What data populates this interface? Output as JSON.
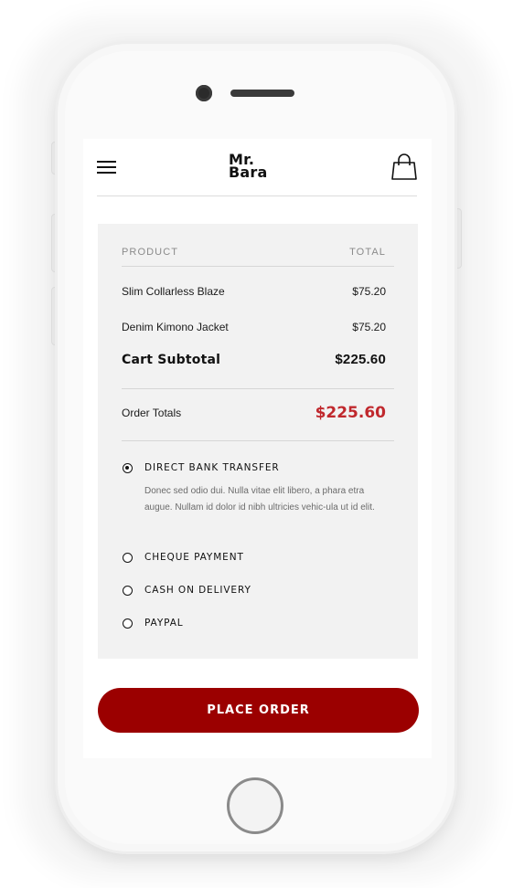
{
  "brand": {
    "line1": "Mr.",
    "line2": "Bara"
  },
  "icons": {
    "menu": "menu-icon",
    "cart": "shopping-bag-icon"
  },
  "order_summary": {
    "columns": {
      "product": "PRODUCT",
      "total": "TOTAL"
    },
    "items": [
      {
        "name": "Slim Collarless Blaze",
        "price": "$75.20"
      },
      {
        "name": "Denim Kimono Jacket",
        "price": "$75.20"
      }
    ],
    "subtotal_label": "Cart Subtotal",
    "subtotal_value": "$225.60",
    "order_totals_label": "Order Totals",
    "order_totals_value": "$225.60"
  },
  "payment_methods": [
    {
      "label": "DIRECT BANK TRANSFER",
      "selected": true,
      "description": "Donec sed odio dui. Nulla vitae elit libero, a phara etra augue. Nullam id dolor id nibh ultricies vehic-ula ut id elit."
    },
    {
      "label": "CHEQUE PAYMENT",
      "selected": false
    },
    {
      "label": "CASH ON DELIVERY",
      "selected": false
    },
    {
      "label": "PAYPAL",
      "selected": false
    }
  ],
  "place_order_label": "PLACE ORDER",
  "colors": {
    "accent": "#9b0000",
    "total_highlight": "#c0282d",
    "panel_bg": "#f2f2f2"
  }
}
